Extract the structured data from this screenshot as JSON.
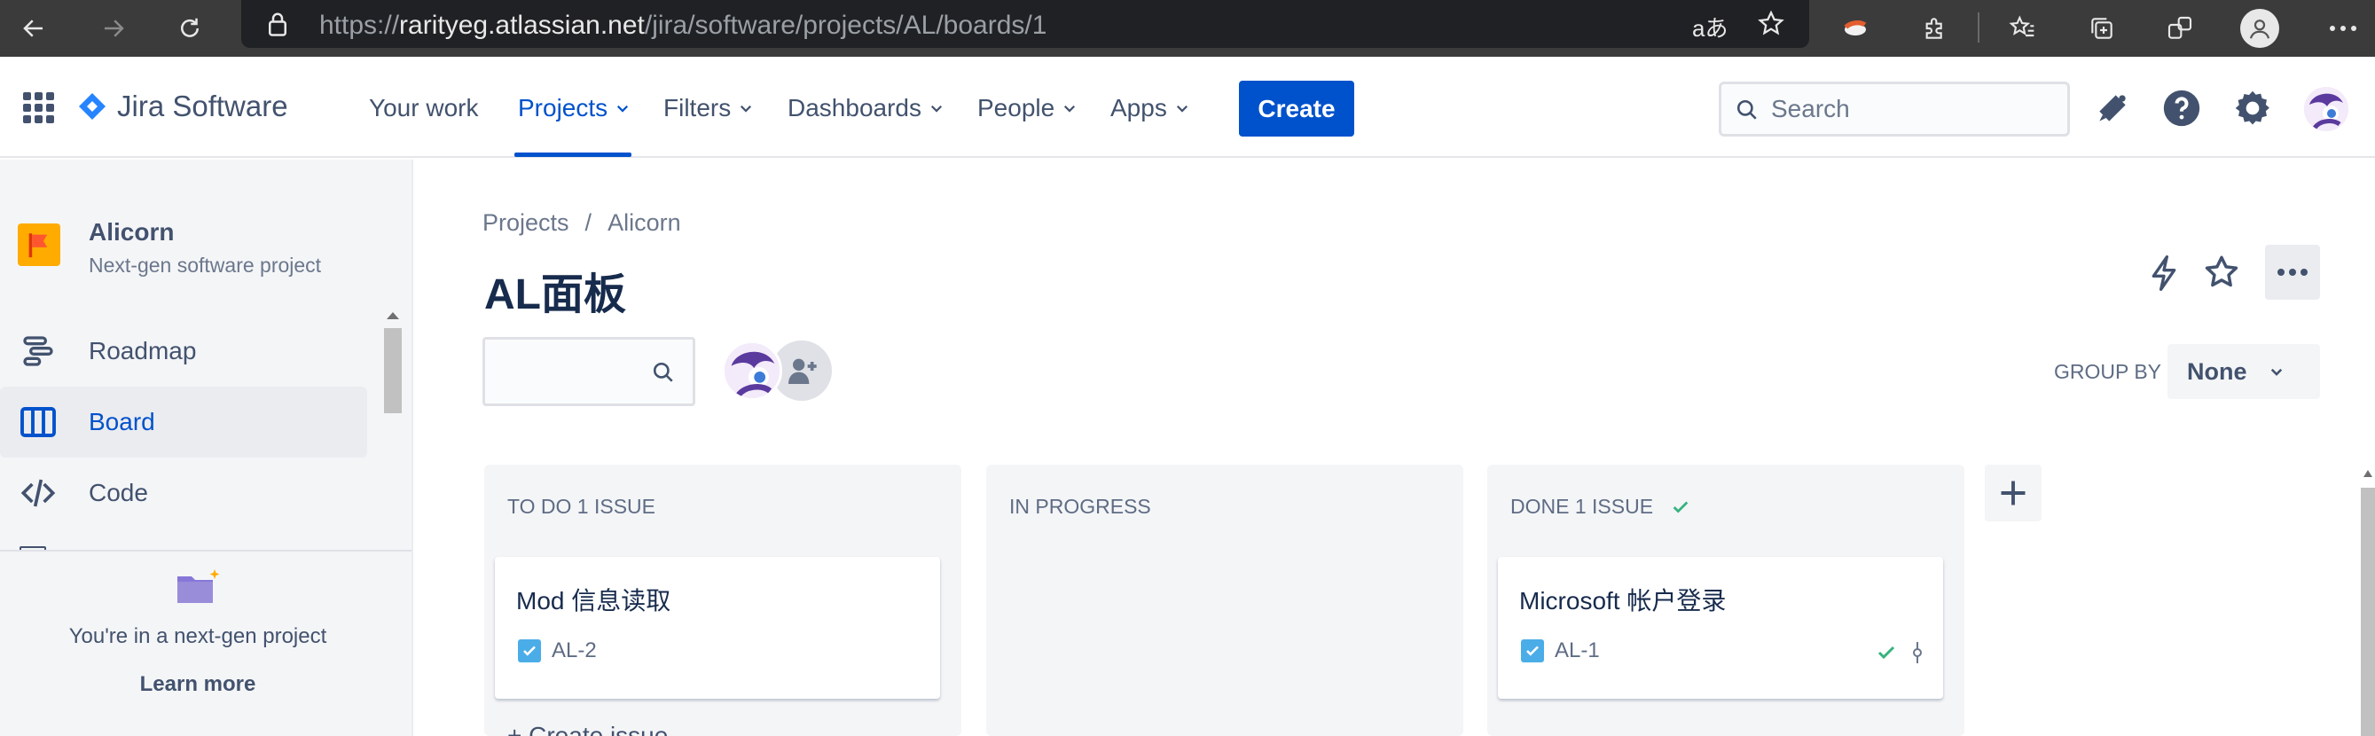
{
  "browser": {
    "url_prefix": "https://",
    "url_host": "rarityeg.atlassian.net",
    "url_path": "/jira/software/projects/AL/boards/1",
    "read_aloud_label": "aあ"
  },
  "nav": {
    "product": "Jira Software",
    "your_work": "Your work",
    "projects": "Projects",
    "filters": "Filters",
    "dashboards": "Dashboards",
    "people": "People",
    "apps": "Apps",
    "create": "Create",
    "search_placeholder": "Search"
  },
  "sidebar": {
    "project_name": "Alicorn",
    "project_type": "Next-gen software project",
    "items": [
      {
        "label": "Roadmap",
        "icon": "roadmap-icon"
      },
      {
        "label": "Board",
        "icon": "board-icon",
        "active": true
      },
      {
        "label": "Code",
        "icon": "code-icon"
      }
    ],
    "footer_text": "You're in a next-gen project",
    "learn_more": "Learn more"
  },
  "main": {
    "breadcrumb": [
      "Projects",
      "/",
      "Alicorn"
    ],
    "title": "AL面板",
    "group_by_label": "GROUP BY",
    "group_by_value": "None",
    "columns": [
      {
        "header": "TO DO 1 ISSUE",
        "cards": [
          {
            "title": "Mod 信息读取",
            "key": "AL-2"
          }
        ],
        "footer": "+ Create issue"
      },
      {
        "header": "IN PROGRESS",
        "cards": []
      },
      {
        "header": "DONE 1 ISSUE",
        "done": true,
        "cards": [
          {
            "title": "Microsoft 帐户登录",
            "key": "AL-1"
          }
        ]
      }
    ]
  },
  "colors": {
    "accent": "#0052cc",
    "done_green": "#36b37e",
    "story_check": "#4bade8"
  }
}
